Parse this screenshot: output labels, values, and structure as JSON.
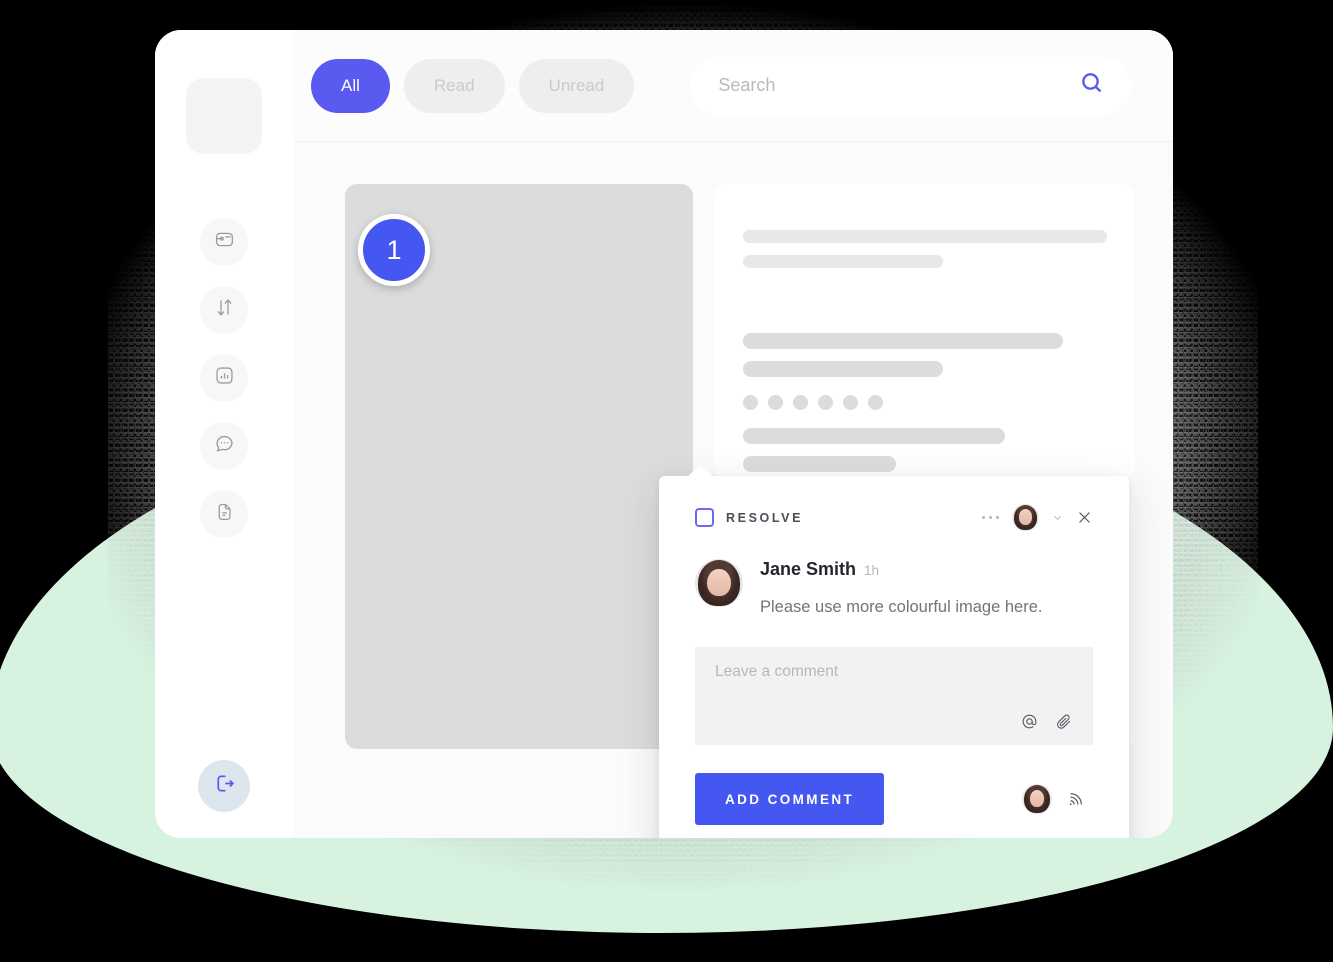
{
  "window": {
    "sidebar": {
      "logo": {
        "name": "logo-placeholder"
      },
      "items": [
        {
          "icon": "inbox-icon",
          "label": "Inbox"
        },
        {
          "icon": "sort-arrows-icon",
          "label": "Transfers"
        },
        {
          "icon": "chart-icon",
          "label": "Reports"
        },
        {
          "icon": "chat-bubble-icon",
          "label": "Messages"
        },
        {
          "icon": "document-icon",
          "label": "Documents"
        }
      ],
      "logout": {
        "icon": "logout-icon",
        "label": "Log out"
      }
    },
    "topbar": {
      "tabs": [
        {
          "label": "All",
          "active": true
        },
        {
          "label": "Read",
          "active": false
        },
        {
          "label": "Unread",
          "active": false
        }
      ],
      "search": {
        "placeholder": "Search",
        "value": "",
        "icon": "search-icon"
      }
    },
    "content": {
      "pin": {
        "number": "1"
      },
      "skeleton_cards": [
        {
          "bars": [
            100,
            55
          ],
          "dots": 0
        },
        {
          "bars": [
            88,
            55
          ],
          "dots": 6,
          "bars2": [
            72,
            42
          ],
          "button": true
        },
        {
          "bars": [
            92,
            46,
            100,
            100,
            30
          ],
          "dots": 0
        }
      ]
    },
    "popup": {
      "resolve": {
        "label": "RESOLVE",
        "checked": false
      },
      "header_icons": {
        "more": "kebab-icon",
        "avatar": "assignee-avatar",
        "chevron": "chevron-down-icon",
        "close": "close-icon"
      },
      "comment": {
        "author": "Jane Smith",
        "time": "1h",
        "text": "Please use more colourful image here."
      },
      "composer": {
        "placeholder": "Leave a comment",
        "value": "",
        "mention_icon": "at-mention-icon",
        "attach_icon": "paperclip-icon"
      },
      "submit_label": "ADD COMMENT",
      "footer": {
        "avatar": "current-user-avatar",
        "subscribe_icon": "broadcast-icon"
      }
    }
  },
  "theme": {
    "accent": "#4457f0",
    "tab_active": "#5a5af0",
    "blob": "#d8f2e0",
    "card_gray": "#dcdcdd",
    "skeleton": "#e8e8e9"
  }
}
